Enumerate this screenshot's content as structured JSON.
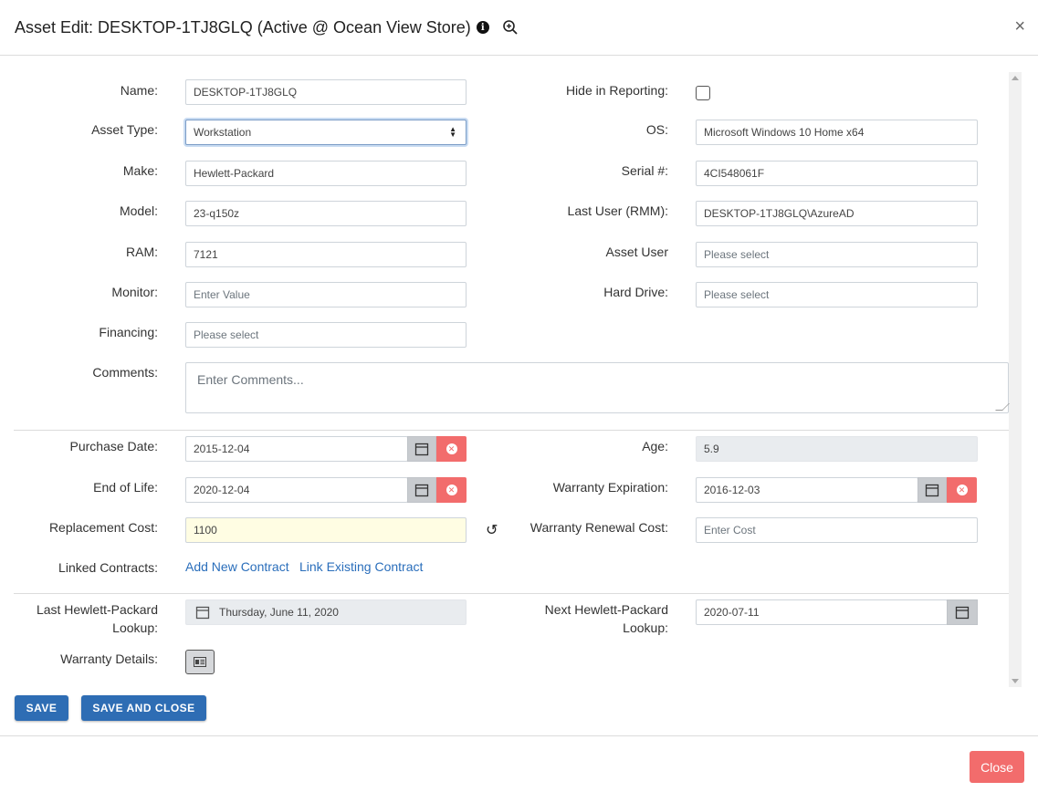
{
  "header": {
    "title": "Asset Edit: DESKTOP-1TJ8GLQ (Active @ Ocean View Store)",
    "info_glyph": "i",
    "close_glyph": "×"
  },
  "fields": {
    "name": {
      "label": "Name:",
      "value": "DESKTOP-1TJ8GLQ"
    },
    "hide_in_reporting": {
      "label": "Hide in Reporting:",
      "checked": false
    },
    "asset_type": {
      "label": "Asset Type:",
      "value": "Workstation"
    },
    "os": {
      "label": "OS:",
      "value": "Microsoft Windows 10 Home x64"
    },
    "make": {
      "label": "Make:",
      "value": "Hewlett-Packard"
    },
    "serial": {
      "label": "Serial #:",
      "value": "4CI548061F"
    },
    "model": {
      "label": "Model:",
      "value": "23-q150z"
    },
    "last_user": {
      "label": "Last User (RMM):",
      "value": "DESKTOP-1TJ8GLQ\\AzureAD"
    },
    "ram": {
      "label": "RAM:",
      "value": "7121"
    },
    "asset_user": {
      "label": "Asset User",
      "placeholder": "Please select"
    },
    "monitor": {
      "label": "Monitor:",
      "placeholder": "Enter Value"
    },
    "hard_drive": {
      "label": "Hard Drive:",
      "placeholder": "Please select"
    },
    "financing": {
      "label": "Financing:",
      "placeholder": "Please select"
    },
    "comments": {
      "label": "Comments:",
      "placeholder": "Enter Comments..."
    },
    "purchase_date": {
      "label": "Purchase Date:",
      "value": "2015-12-04"
    },
    "age": {
      "label": "Age:",
      "value": "5.9"
    },
    "end_of_life": {
      "label": "End of Life:",
      "value": "2020-12-04"
    },
    "warranty_expiration": {
      "label": "Warranty Expiration:",
      "value": "2016-12-03"
    },
    "replacement_cost": {
      "label": "Replacement Cost:",
      "value": "1100",
      "reset_glyph": "↺"
    },
    "warranty_renewal_cost": {
      "label": "Warranty Renewal Cost:",
      "placeholder": "Enter Cost"
    },
    "linked_contracts": {
      "label": "Linked Contracts:",
      "add_link": "Add New Contract",
      "link_existing": "Link Existing Contract"
    },
    "last_lookup": {
      "label_line1": "Last Hewlett-Packard",
      "label_line2": "Lookup:",
      "value": "Thursday, June 11, 2020"
    },
    "next_lookup": {
      "label_line1": "Next Hewlett-Packard",
      "label_line2": "Lookup:",
      "value": "2020-07-11"
    },
    "warranty_details": {
      "label": "Warranty Details:"
    }
  },
  "actions": {
    "save": "SAVE",
    "save_and_close": "SAVE AND CLOSE",
    "close": "Close"
  },
  "colors": {
    "primary": "#2e6db4",
    "danger": "#f26c6c",
    "link": "#2a6ebb",
    "highlight_input": "#fffde3"
  }
}
